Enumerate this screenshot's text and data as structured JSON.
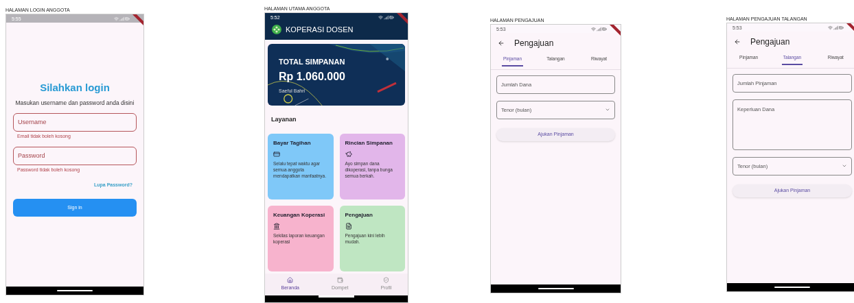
{
  "screens": [
    {
      "kind": "login",
      "caption": "HALAMAN LOGIN ANGGOTA",
      "time": "5:55",
      "title": "Silahkan login",
      "subtitle": "Masukan username dan password anda disini",
      "fields": [
        {
          "label": "Username",
          "error": "Email tidak boleh kosong"
        },
        {
          "label": "Password",
          "error": "Password tidak boleh kosong"
        }
      ],
      "link": "Lupa Password?",
      "button": "Sign in"
    },
    {
      "kind": "home",
      "caption": "HALAMAN UTAMA ANGGOTA",
      "time": "5:52",
      "app_title": "KOPERASI DOSEN",
      "balance": {
        "label": "TOTAL SIMPANAN",
        "amount": "Rp 1.060.000",
        "owner": "Saeful Bahri"
      },
      "section": "Layanan",
      "services": [
        {
          "title": "Bayar Tagihan",
          "text": "Selalu tepat waktu agar semua anggota mendapatkan manfaatnya.",
          "color": "#7fc8f8"
        },
        {
          "title": "Rincian Simpanan",
          "text": "Ayo simpan dana dikoperasi, tanpa bunga semua berkah.",
          "color": "#e2b6ea"
        },
        {
          "title": "Keuangan Koperasi",
          "text": "Sekilas laporan keuangan koperasi",
          "color": "#f7b3cd"
        },
        {
          "title": "Pengajuan",
          "text": "Pengajuan kini lebih mudah.",
          "color": "#bfe6c2"
        }
      ],
      "nav": [
        {
          "label": "Beranda",
          "selected": true
        },
        {
          "label": "Dompet",
          "selected": false
        },
        {
          "label": "Profil",
          "selected": false
        }
      ]
    },
    {
      "kind": "form",
      "caption": "HALAMAN PENGAJUAN",
      "time": "5:53",
      "title": "Pengajuan",
      "tabs": [
        {
          "label": "Pinjaman",
          "selected": true
        },
        {
          "label": "Talangan",
          "selected": false
        },
        {
          "label": "Riwayat",
          "selected": false
        }
      ],
      "fields": [
        {
          "kind": "text",
          "placeholder": "Jumlah Dana"
        },
        {
          "kind": "dropdown",
          "placeholder": "Tenor (bulan)"
        }
      ],
      "button": "Ajukan Pinjaman"
    },
    {
      "kind": "form",
      "caption": "HALAMAN PENGAJUAN TALANGAN",
      "time": "5:53",
      "title": "Pengajuan",
      "tabs": [
        {
          "label": "Pinjaman",
          "selected": false
        },
        {
          "label": "Talangan",
          "selected": true
        },
        {
          "label": "Riwayat",
          "selected": false
        }
      ],
      "fields": [
        {
          "kind": "text",
          "placeholder": "Jumlah Pinjaman"
        },
        {
          "kind": "textarea",
          "placeholder": "Keperluan Dana"
        },
        {
          "kind": "dropdown",
          "placeholder": "Tenor (bulan)"
        }
      ],
      "button": "Ajukan Pinjaman"
    }
  ]
}
